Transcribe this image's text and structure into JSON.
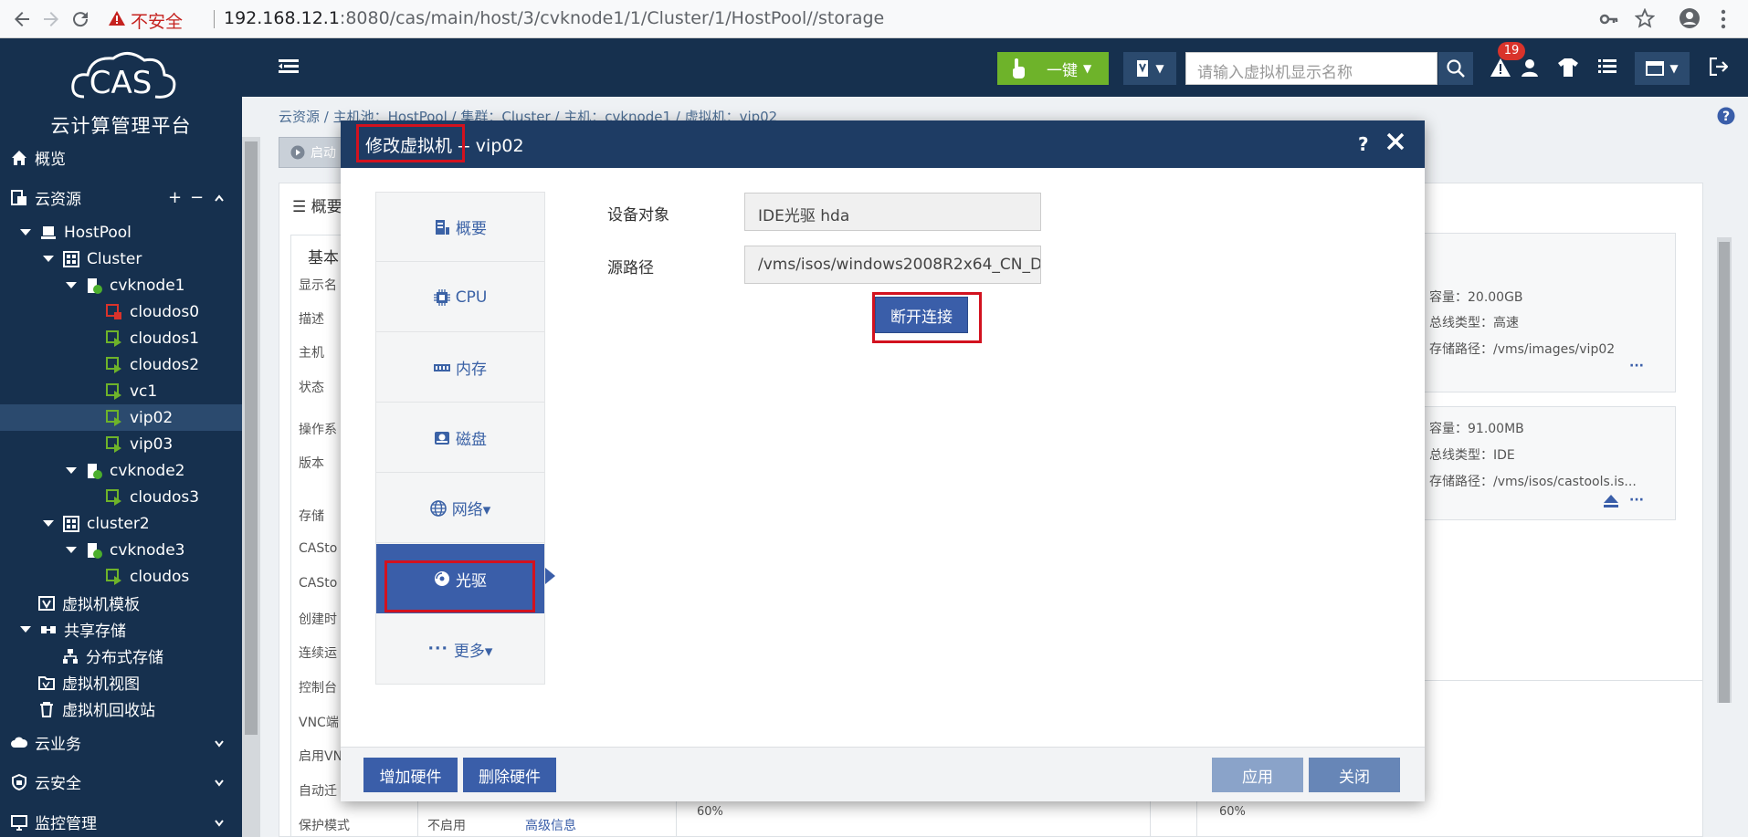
{
  "browser": {
    "insecure_label": "不安全",
    "url_host": "192.168.12.1",
    "url_rest": ":8080/cas/main/host/3/cvknode1/1/Cluster/1/HostPool//storage"
  },
  "header": {
    "one_key_label": "一键",
    "search_placeholder": "请输入虚拟机显示名称",
    "alert_count": "19"
  },
  "sidebar": {
    "logo_text": "CAS",
    "subtitle": "云计算管理平台",
    "items": [
      {
        "label": "概览"
      },
      {
        "label": "云资源"
      },
      {
        "label": "HostPool"
      },
      {
        "label": "Cluster"
      },
      {
        "label": "cvknode1"
      },
      {
        "label": "cloudos0"
      },
      {
        "label": "cloudos1"
      },
      {
        "label": "cloudos2"
      },
      {
        "label": "vc1"
      },
      {
        "label": "vip02"
      },
      {
        "label": "vip03"
      },
      {
        "label": "cvknode2"
      },
      {
        "label": "cloudos3"
      },
      {
        "label": "cluster2"
      },
      {
        "label": "cvknode3"
      },
      {
        "label": "cloudos"
      },
      {
        "label": "虚拟机模板"
      },
      {
        "label": "共享存储"
      },
      {
        "label": "分布式存储"
      },
      {
        "label": "虚拟机视图"
      },
      {
        "label": "虚拟机回收站"
      },
      {
        "label": "云业务"
      },
      {
        "label": "云安全"
      },
      {
        "label": "监控管理"
      }
    ],
    "plus": "+",
    "minus": "−"
  },
  "background": {
    "breadcrumb": "云资源 /   主机池：HostPool /   集群：Cluster /   主机：cvknode1 /   虚拟机：vip02",
    "start_label": "启动",
    "overview_label": "概要",
    "basic_label": "基本",
    "fields": [
      "显示名",
      "描述",
      "主机",
      "状态",
      "操作系",
      "版本",
      "存储",
      "CASto",
      "CASto",
      "创建时",
      "连续运",
      "控制台",
      "VNC端",
      "启用VN",
      "自动迁",
      "保护模式"
    ],
    "protect_value": "不启用",
    "advanced_link": "高级信息",
    "disk1": {
      "capacity": "容量：20.00GB",
      "bus": "总线类型：高速",
      "path": "存储路径：/vms/images/vip02"
    },
    "disk2": {
      "capacity": "容量：91.00MB",
      "bus": "总线类型：IDE",
      "path": "存储路径：/vms/isos/castools.is..."
    },
    "pct_left": "60%",
    "pct_right": "60%",
    "more": "···"
  },
  "modal": {
    "title": "修改虚拟机 -- vip02",
    "help": "?",
    "tabs": [
      {
        "label": "概要"
      },
      {
        "label": "CPU"
      },
      {
        "label": "内存"
      },
      {
        "label": "磁盘"
      },
      {
        "label": "网络▾"
      },
      {
        "label": "光驱"
      },
      {
        "label": "更多▾"
      }
    ],
    "device_label": "设备对象",
    "device_value": "IDE光驱 hda",
    "source_label": "源路径",
    "source_value": "/vms/isos/windows2008R2x64_CN_D",
    "disconnect_label": "断开连接",
    "add_hw": "增加硬件",
    "del_hw": "删除硬件",
    "apply": "应用",
    "close": "关闭"
  },
  "colors": {
    "sidebar": "#16304e",
    "accent": "#3a5ea9",
    "highlight": "#d2121f",
    "green_btn": "#6eb32a"
  }
}
